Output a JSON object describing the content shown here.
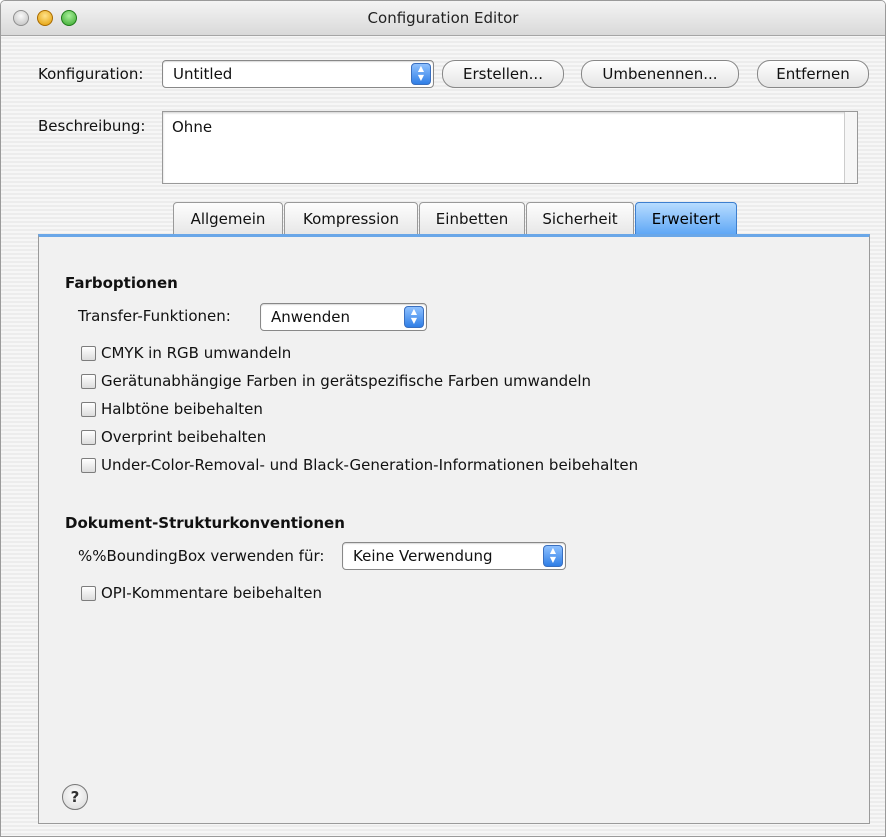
{
  "window": {
    "title": "Configuration Editor"
  },
  "config": {
    "label": "Konfiguration:",
    "selected": "Untitled",
    "buttons": {
      "create": "Erstellen...",
      "rename": "Umbenennen...",
      "remove": "Entfernen"
    }
  },
  "description": {
    "label": "Beschreibung:",
    "value": "Ohne"
  },
  "tabs": [
    {
      "label": "Allgemein",
      "active": false
    },
    {
      "label": "Kompression",
      "active": false
    },
    {
      "label": "Einbetten",
      "active": false
    },
    {
      "label": "Sicherheit",
      "active": false
    },
    {
      "label": "Erweitert",
      "active": true
    }
  ],
  "color_options": {
    "title": "Farboptionen",
    "transfer_label": "Transfer-Funktionen:",
    "transfer_value": "Anwenden",
    "checkboxes": [
      {
        "label": "CMYK in RGB umwandeln",
        "checked": false
      },
      {
        "label": "Gerätunabhängige Farben in gerätspezifische Farben umwandeln",
        "checked": false
      },
      {
        "label": "Halbtöne beibehalten",
        "checked": false
      },
      {
        "label": "Overprint beibehalten",
        "checked": false
      },
      {
        "label": "Under-Color-Removal- und Black-Generation-Informationen beibehalten",
        "checked": false
      }
    ]
  },
  "doc_structure": {
    "title": "Dokument-Strukturkonventionen",
    "bbox_label": "%%BoundingBox verwenden für:",
    "bbox_value": "Keine Verwendung",
    "checkboxes": [
      {
        "label": "OPI-Kommentare beibehalten",
        "checked": false
      }
    ]
  },
  "help": {
    "glyph": "?"
  }
}
